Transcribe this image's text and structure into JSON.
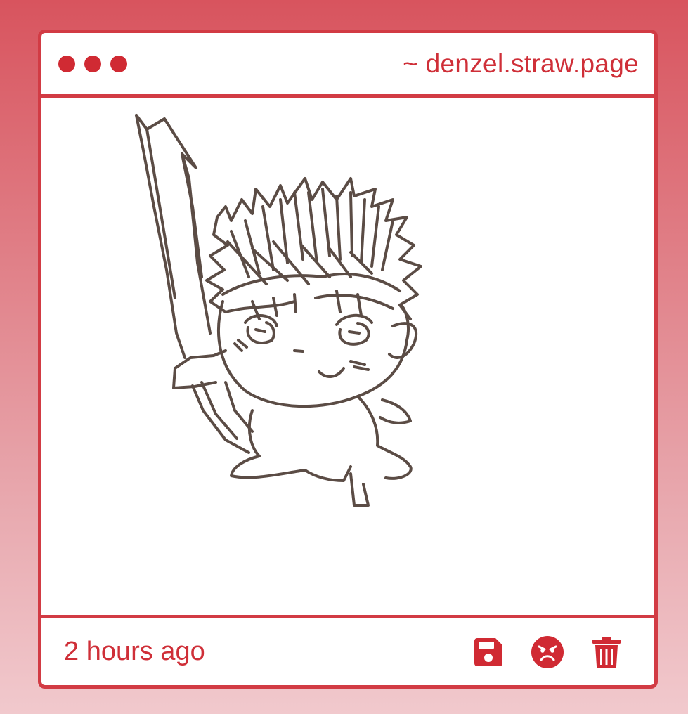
{
  "window": {
    "controls": [
      "dot",
      "dot",
      "dot"
    ],
    "url": "~ denzel.straw.page"
  },
  "drawing": {
    "subject": "hand-drawn chibi character holding a sword",
    "stroke_color": "#5b4c45"
  },
  "footer": {
    "timestamp": "2 hours ago",
    "actions": [
      {
        "icon": "save-icon"
      },
      {
        "icon": "angry-face-icon"
      },
      {
        "icon": "trash-icon"
      }
    ]
  },
  "colors": {
    "accent": "#d23b44",
    "text": "#cf2f38",
    "background_top": "#d8545e",
    "background_bottom": "#f1c9cd"
  }
}
